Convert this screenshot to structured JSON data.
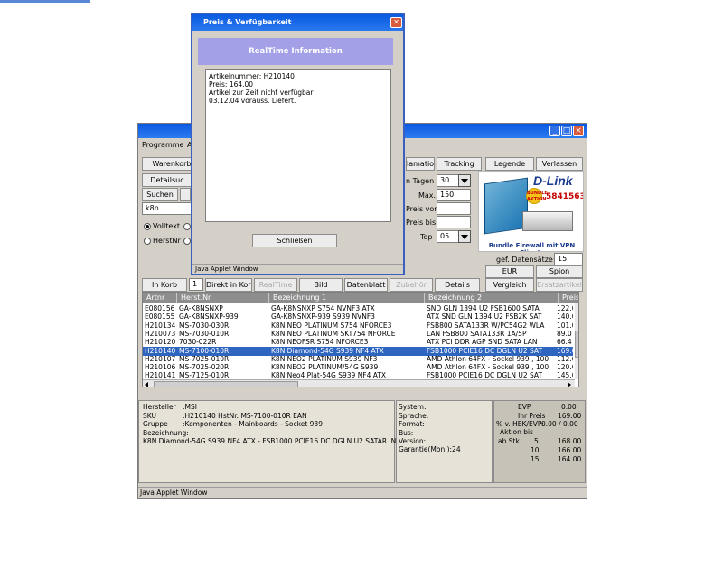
{
  "main_window": {
    "menu": [
      "Programme",
      "A"
    ],
    "toolbar_row1": [
      "Warenkorb",
      "lamation",
      "Tracking",
      "Legende",
      "Verlassen"
    ],
    "detailsuche_label": "Detailsuc",
    "suchen_label": "Suchen",
    "search_value": "k8n",
    "radio_volltext": "Volltext",
    "radio_herstnr": "HerstNr",
    "form_labels": {
      "tagen": "n Tagen",
      "max": "Max.:",
      "preis_von": "Preis von:",
      "preis_bis": "Preis bis:",
      "top": "Top"
    },
    "form_values": {
      "tagen": "30",
      "max": "150",
      "preis_von": "",
      "preis_bis": "",
      "top": "05"
    },
    "gef_datensaetze_label": "gef. Datensätze:",
    "gef_datensaetze_value": "15",
    "eur_button": "EUR",
    "spion_button": "Spion",
    "ad": {
      "brand": "D-Link",
      "badge": "BUNDLE AKTION",
      "number": "5841563",
      "caption": "Bundle Firewall mit VPN Clients"
    },
    "action_bar": {
      "in_korb": "In Korb",
      "qty": "1",
      "direkt_in_korb": "Direkt in Korb",
      "realtime": "RealTime",
      "bild": "Bild",
      "datenblatt": "Datenblatt",
      "zubehoer": "Zubehör",
      "details": "Details",
      "vergleich": "Vergleich",
      "ersatzartikel": "Ersatzartikel"
    },
    "table": {
      "columns": [
        "Artnr",
        "Herst.Nr",
        "Bezeichnung 1",
        "Bezeichnung 2",
        "Preis"
      ],
      "rows": [
        {
          "artnr": "E080156",
          "herst": "GA-K8NSNXP",
          "bez1": "GA-K8NSNXP S754 NVNF3 ATX",
          "bez2": "SND GLN 1394 U2 FSB1600 SATA",
          "preis": "122.0"
        },
        {
          "artnr": "E080155",
          "herst": "GA-K8NSNXP-939",
          "bez1": "GA-K8NSNXP-939 S939 NVNF3",
          "bez2": "ATX SND GLN 1394 U2 FSB2K SAT",
          "preis": "140.0"
        },
        {
          "artnr": "H210134",
          "herst": "MS-7030-030R",
          "bez1": "K8N NEO PLATINUM S754 NFORCE3",
          "bez2": "FSB800 SATA133R W/PC54G2 WLA",
          "preis": "101.0"
        },
        {
          "artnr": "H210073",
          "herst": "MS-7030-010R",
          "bez1": "K8N NEO PLATINUM SKT754 NFORCE",
          "bez2": "LAN FSB800 SATA133R 1A/5P",
          "preis": "89.0"
        },
        {
          "artnr": "H210120",
          "herst": "7030-022R",
          "bez1": "K8N NEOFSR S754 NFORCE3",
          "bez2": "ATX PCI DDR AGP SND SATA LAN",
          "preis": "66.4"
        },
        {
          "artnr": "H210140",
          "herst": "MS-7100-010R",
          "bez1": "K8N Diamond-54G S939 NF4 ATX",
          "bez2": "FSB1000 PCIE16 DC DGLN U2 SAT",
          "preis": "169.0"
        },
        {
          "artnr": "H210107",
          "herst": "MS-7025-010R",
          "bez1": "K8N NEO2 PLATINUM S939 NF3",
          "bez2": "AMD Athlon 64FX - Sockel 939 , 100",
          "preis": "112.0"
        },
        {
          "artnr": "H210106",
          "herst": "MS-7025-020R",
          "bez1": "K8N NEO2 PLATINUM/54G S939",
          "bez2": "AMD Athlon 64FX - Sockel 939 , 100",
          "preis": "120.0"
        },
        {
          "artnr": "H210141",
          "herst": "MS-7125-010R",
          "bez1": "K8N Neo4 Plat-54G S939 NF4 ATX",
          "bez2": "FSB1000 PCIE16 DC DGLN U2 SAT",
          "preis": "145.0"
        }
      ]
    },
    "details": {
      "hersteller_label": "Hersteller",
      "hersteller_value": ":MSI",
      "sku_label": "SKU",
      "sku_value": ":H210140  HstNr. MS-7100-010R  EAN",
      "gruppe_label": "Gruppe",
      "gruppe_value": ":Komponenten - Mainboards - Socket 939",
      "bezeichnung_label": "Bezeichnung:",
      "bezeichnung_value": "K8N Diamond-54G S939 NF4 ATX - FSB1000 PCIE16 DC DGLN U2 SATAR  IN"
    },
    "spec": {
      "system": "System:",
      "sprache": "Sprache:",
      "format": "Format:",
      "bus": "Bus:",
      "version": "Version:",
      "garantie": "Garantie(Mon.):24"
    },
    "price_panel": {
      "evp_label": "EVP",
      "evp_value": "0.00",
      "ihr_preis_label": "Ihr Preis",
      "ihr_preis_value": "169.00",
      "hek_label": "% v. HEK/EVP:",
      "hek_value": "0.00 / 0.00",
      "aktion_label": "Aktion bis",
      "abstk_label": "ab Stk",
      "tiers": [
        {
          "qty": "5",
          "price": "168.00"
        },
        {
          "qty": "10",
          "price": "166.00"
        },
        {
          "qty": "15",
          "price": "164.00"
        }
      ]
    },
    "status": "Java Applet Window"
  },
  "dialog": {
    "title": "Preis & Verfügbarkeit",
    "banner": "RealTime Information",
    "lines": [
      "Artikelnummer: H210140",
      "Preis: 164.00",
      "Artikel zur Zeit nicht verfügbar",
      "03.12.04 vorauss. Liefert."
    ],
    "close_button": "Schließen",
    "status": "Java Applet Window"
  },
  "colors": {
    "titlebar": "#0a58e0",
    "banner": "#a3a0e8",
    "selected_row": "#2e65c0",
    "window_bg": "#d4d0c8"
  }
}
